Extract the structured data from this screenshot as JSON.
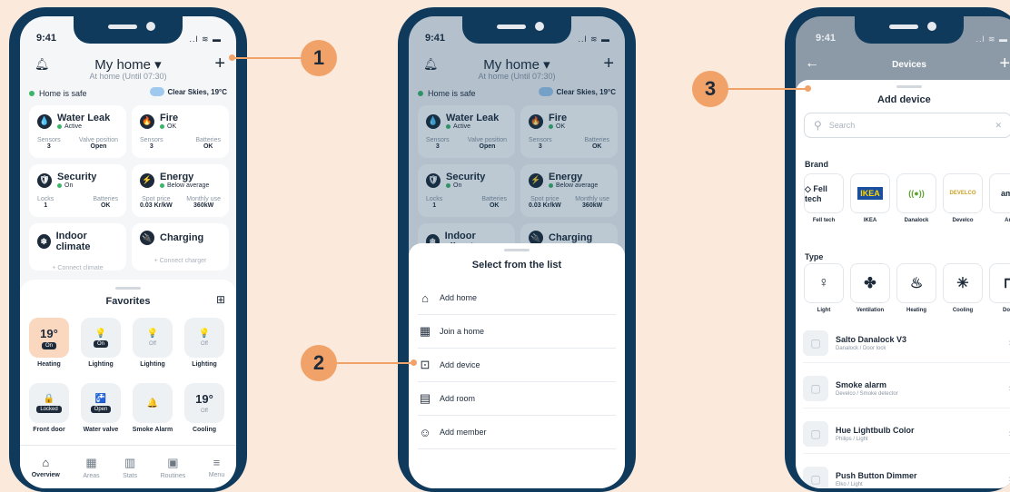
{
  "time": "9:41",
  "signal": "..l ≋ ▬",
  "home": {
    "title": "My home",
    "subtitle": "At home (Until 07:30)",
    "bell": "bell-icon",
    "plus": "+",
    "safe": "Home is safe",
    "weather": "Clear Skies, 19°C"
  },
  "cards": [
    {
      "title": "Water Leak",
      "status": "Active",
      "icon": "💧",
      "stats": [
        {
          "label": "Sensors",
          "value": "3"
        },
        {
          "label": "Valve position",
          "value": "Open"
        }
      ]
    },
    {
      "title": "Fire",
      "status": "OK",
      "icon": "🔥",
      "stats": [
        {
          "label": "Sensors",
          "value": "3"
        },
        {
          "label": "Batteries",
          "value": "OK"
        }
      ]
    },
    {
      "title": "Security",
      "status": "On",
      "icon": "🛡",
      "stats": [
        {
          "label": "Locks",
          "value": "1"
        },
        {
          "label": "Batteries",
          "value": "OK"
        }
      ]
    },
    {
      "title": "Energy",
      "status": "Below average",
      "icon": "⚡",
      "stats": [
        {
          "label": "Spot price",
          "value": "0.03 Kr/kW"
        },
        {
          "label": "Monthly use",
          "value": "360kW"
        }
      ]
    },
    {
      "title": "Indoor climate",
      "connect": "+ Connect climate",
      "icon": "❄"
    },
    {
      "title": "Charging",
      "connect": "+ Connect charger",
      "icon": "🔌"
    }
  ],
  "favorites": {
    "title": "Favorites",
    "tiles": [
      {
        "big": "19°",
        "state": "On",
        "label": "Heating"
      },
      {
        "glyph": "💡",
        "state": "On",
        "label": "Lighting"
      },
      {
        "glyph": "💡",
        "state": "Off",
        "label": "Lighting"
      },
      {
        "glyph": "💡",
        "state": "Off",
        "label": "Lighting"
      },
      {
        "glyph": "🔒",
        "state": "Locked",
        "label": "Front door"
      },
      {
        "glyph": "🚰",
        "state": "Open",
        "label": "Water valve"
      },
      {
        "glyph": "🔔",
        "state": "",
        "label": "Smoke Alarm"
      },
      {
        "big": "19°",
        "state": "Off",
        "label": "Cooling"
      }
    ]
  },
  "nav": [
    {
      "label": "Overview",
      "icon": "⌂"
    },
    {
      "label": "Areas",
      "icon": "▦"
    },
    {
      "label": "Stats",
      "icon": "▥"
    },
    {
      "label": "Routines",
      "icon": "▣"
    },
    {
      "label": "Menu",
      "icon": "≡"
    }
  ],
  "sheet": {
    "title": "Select from the list",
    "items": [
      {
        "label": "Add home",
        "icon": "⌂"
      },
      {
        "label": "Join a home",
        "icon": "▦"
      },
      {
        "label": "Add device",
        "icon": "⊡"
      },
      {
        "label": "Add room",
        "icon": "▤"
      },
      {
        "label": "Add member",
        "icon": "☺"
      }
    ]
  },
  "devices": {
    "header": "Devices",
    "back": "←",
    "plus": "+",
    "sheet_title": "Add device",
    "search_placeholder": "Search",
    "clear": "✕",
    "brand_title": "Brand",
    "brands": [
      {
        "name": "Fell tech",
        "logo": "◇ Fell tech"
      },
      {
        "name": "IKEA",
        "logo": "IKEA"
      },
      {
        "name": "Danalock",
        "logo": "((●))"
      },
      {
        "name": "Develco",
        "logo": "DEVELCO"
      },
      {
        "name": "Am",
        "logo": "ama"
      }
    ],
    "type_title": "Type",
    "types": [
      {
        "name": "Light",
        "icon": "♀"
      },
      {
        "name": "Ventilation",
        "icon": "✤"
      },
      {
        "name": "Heating",
        "icon": "♨"
      },
      {
        "name": "Cooling",
        "icon": "✳"
      },
      {
        "name": "Door",
        "icon": "⊓"
      }
    ],
    "list": [
      {
        "name": "Salto Danalock V3",
        "sub": "Danalock / Door lock"
      },
      {
        "name": "Smoke alarm",
        "sub": "Develco / Smoke detector"
      },
      {
        "name": "Hue Lightbulb Color",
        "sub": "Philips / Light"
      },
      {
        "name": "Push Button Dimmer",
        "sub": "Elko / Light"
      }
    ]
  },
  "badges": [
    "1",
    "2",
    "3"
  ],
  "colors": {
    "navy": "#0f3a5c",
    "accent": "#f1a268",
    "green": "#3cb56b",
    "background": "#fbe9dc"
  }
}
